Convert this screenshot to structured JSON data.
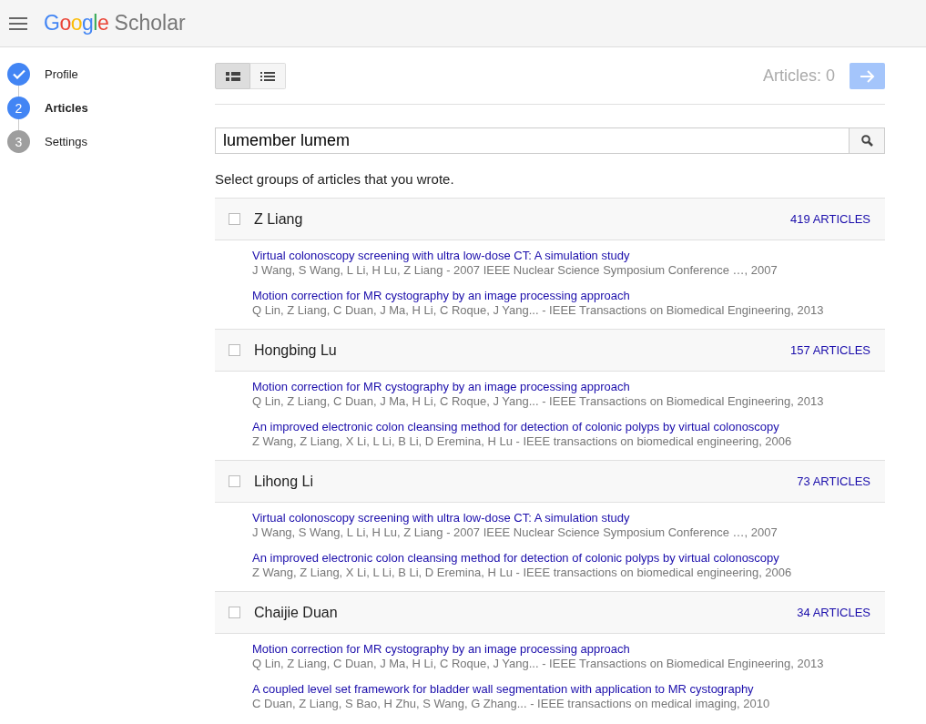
{
  "header": {
    "logo_brand": "Google",
    "logo_product": "Scholar"
  },
  "steps": [
    {
      "label": "Profile",
      "completed": true,
      "selected": false
    },
    {
      "label": "Articles",
      "number": "2",
      "completed": false,
      "selected": true
    },
    {
      "label": "Settings",
      "number": "3",
      "completed": false,
      "selected": false
    }
  ],
  "view_toggle": [
    {
      "kind": "detailed",
      "selected": true
    },
    {
      "kind": "compact",
      "selected": false
    }
  ],
  "article_count": "Articles: 0",
  "next_button": {
    "disabled": true
  },
  "search": {
    "value": "lumember lumem"
  },
  "instruction": "Select groups of articles that you wrote.",
  "groups": [
    {
      "name": "Z Liang",
      "count": "419 ARTICLES",
      "checked": false,
      "articles": [
        {
          "title": "Virtual colonoscopy screening with ultra low-dose CT: A simulation study",
          "meta": "J Wang, S Wang, L Li, H Lu, Z Liang - 2007 IEEE Nuclear Science Symposium Conference …, 2007"
        },
        {
          "title": "Motion correction for MR cystography by an image processing approach",
          "meta": "Q Lin, Z Liang, C Duan, J Ma, H Li, C Roque, J Yang... - IEEE Transactions on Biomedical Engineering, 2013"
        }
      ]
    },
    {
      "name": "Hongbing Lu",
      "count": "157 ARTICLES",
      "checked": false,
      "articles": [
        {
          "title": "Motion correction for MR cystography by an image processing approach",
          "meta": "Q Lin, Z Liang, C Duan, J Ma, H Li, C Roque, J Yang... - IEEE Transactions on Biomedical Engineering, 2013"
        },
        {
          "title": "An improved electronic colon cleansing method for detection of colonic polyps by virtual colonoscopy",
          "meta": "Z Wang, Z Liang, X Li, L Li, B Li, D Eremina, H Lu - IEEE transactions on biomedical engineering, 2006"
        }
      ]
    },
    {
      "name": "Lihong Li",
      "count": "73 ARTICLES",
      "checked": false,
      "articles": [
        {
          "title": "Virtual colonoscopy screening with ultra low-dose CT: A simulation study",
          "meta": "J Wang, S Wang, L Li, H Lu, Z Liang - 2007 IEEE Nuclear Science Symposium Conference …, 2007"
        },
        {
          "title": "An improved electronic colon cleansing method for detection of colonic polyps by virtual colonoscopy",
          "meta": "Z Wang, Z Liang, X Li, L Li, B Li, D Eremina, H Lu - IEEE transactions on biomedical engineering, 2006"
        }
      ]
    },
    {
      "name": "Chaijie Duan",
      "count": "34 ARTICLES",
      "checked": false,
      "articles": [
        {
          "title": "Motion correction for MR cystography by an image processing approach",
          "meta": "Q Lin, Z Liang, C Duan, J Ma, H Li, C Roque, J Yang... - IEEE Transactions on Biomedical Engineering, 2013"
        },
        {
          "title": "A coupled level set framework for bladder wall segmentation with application to MR cystography",
          "meta": "C Duan, Z Liang, S Bao, H Zhu, S Wang, G Zhang... - IEEE transactions on medical imaging, 2010"
        }
      ]
    }
  ]
}
